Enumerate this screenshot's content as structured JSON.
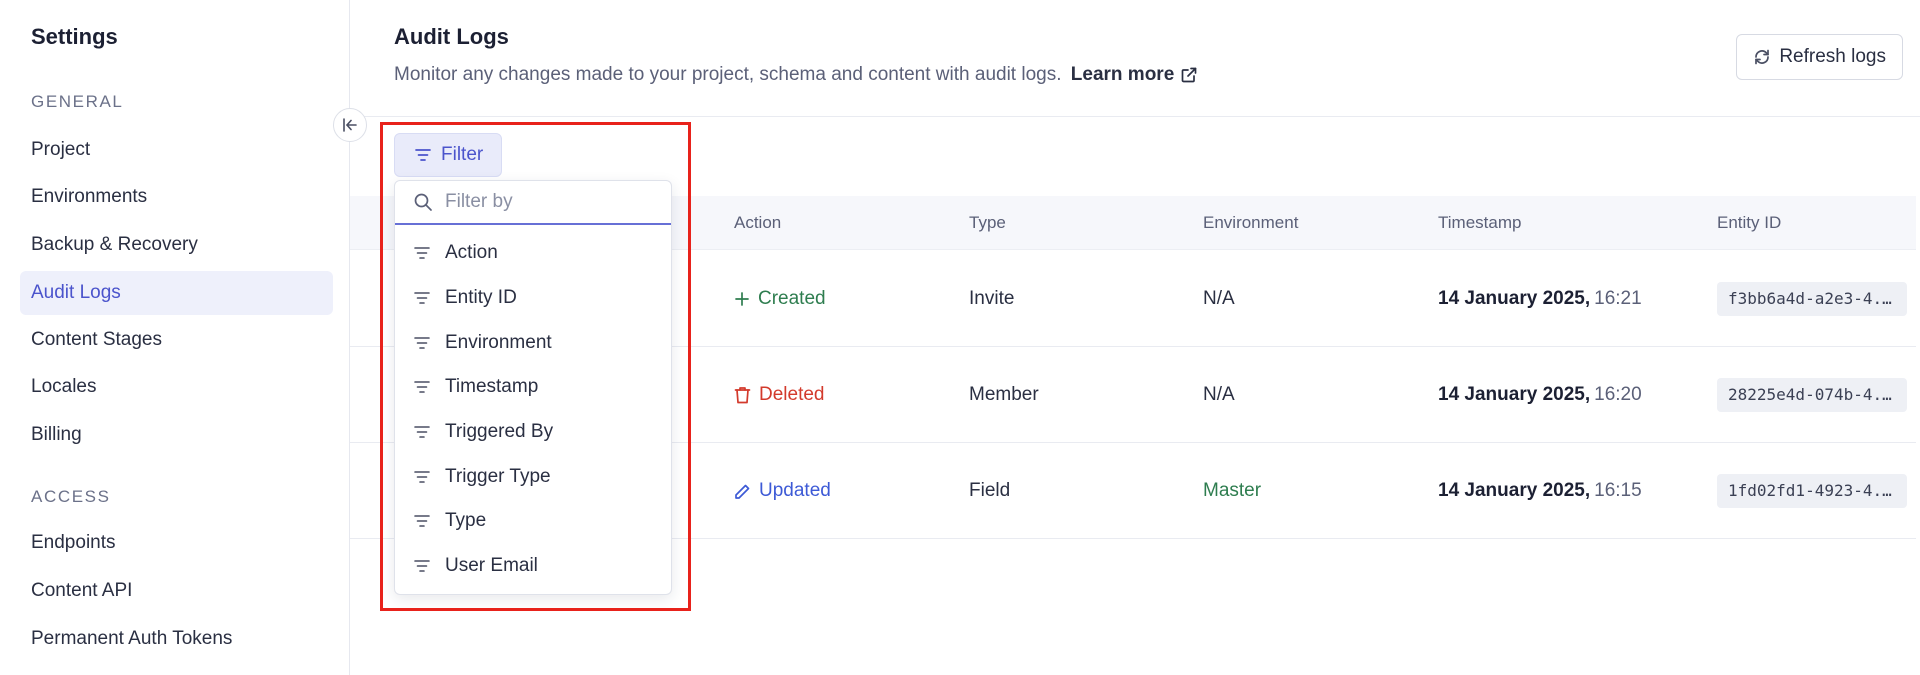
{
  "sidebar": {
    "title": "Settings",
    "sections": [
      {
        "label": "GENERAL",
        "items": [
          "Project",
          "Environments",
          "Backup & Recovery",
          "Audit Logs",
          "Content Stages",
          "Locales",
          "Billing"
        ]
      },
      {
        "label": "ACCESS",
        "items": [
          "Endpoints",
          "Content API",
          "Permanent Auth Tokens"
        ]
      }
    ],
    "active": "Audit Logs"
  },
  "header": {
    "title": "Audit Logs",
    "description": "Monitor any changes made to your project, schema and content with audit logs.",
    "learn_more": "Learn more",
    "refresh_label": "Refresh logs"
  },
  "filter": {
    "button_label": "Filter",
    "search_placeholder": "Filter by",
    "options": [
      "Action",
      "Entity ID",
      "Environment",
      "Timestamp",
      "Triggered By",
      "Trigger Type",
      "Type",
      "User Email"
    ]
  },
  "table": {
    "columns": [
      "Action",
      "Type",
      "Environment",
      "Timestamp",
      "Entity ID"
    ],
    "rows": [
      {
        "trunc": "m",
        "action": "Created",
        "type": "Invite",
        "environment": "N/A",
        "date": "14 January 2025,",
        "time": "16:21",
        "entity_id": "f3bb6a4d-a2e3-4..."
      },
      {
        "trunc": "m",
        "action": "Deleted",
        "type": "Member",
        "environment": "N/A",
        "date": "14 January 2025,",
        "time": "16:20",
        "entity_id": "28225e4d-074b-4..."
      },
      {
        "trunc": "m",
        "action": "Updated",
        "type": "Field",
        "environment": "Master",
        "date": "14 January 2025,",
        "time": "16:15",
        "entity_id": "1fd02fd1-4923-4..."
      }
    ]
  },
  "colors": {
    "accent": "#4b54cc",
    "created": "#2e7d4f",
    "deleted": "#d33a2c",
    "updated": "#3d5ad6",
    "highlight": "#e8221b"
  }
}
